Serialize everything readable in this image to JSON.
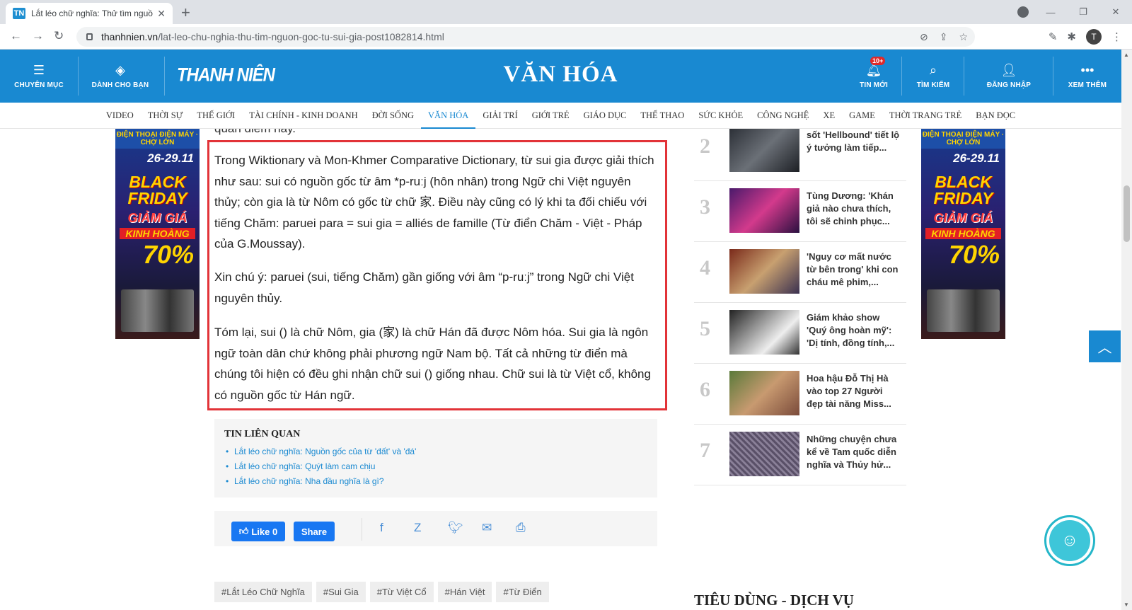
{
  "browser": {
    "tab_title": "Lắt léo chữ nghĩa: Thử tìm nguồn",
    "tab_favicon": "TN",
    "url_domain": "thanhnien.vn",
    "url_path": "/lat-leo-chu-nghia-thu-tim-nguon-goc-tu-sui-gia-post1082814.html",
    "profile_initial": "T"
  },
  "header": {
    "menu_label": "CHUYÊN MỤC",
    "for_you_label": "DÀNH CHO BẠN",
    "logo": "THANH NIÊN",
    "section": "VĂN HÓA",
    "news_label": "TIN MỚI",
    "news_badge": "10+",
    "search_label": "TÌM KIẾM",
    "login_label": "ĐĂNG NHẬP",
    "more_label": "XEM THÊM",
    "colors": {
      "brand": "#1989d1",
      "highlight": "#e23338"
    }
  },
  "categories": [
    "VIDEO",
    "THỜI SỰ",
    "THẾ GIỚI",
    "TÀI CHÍNH - KINH DOANH",
    "ĐỜI SỐNG",
    "VĂN HÓA",
    "GIẢI TRÍ",
    "GIỚI TRẺ",
    "GIÁO DỤC",
    "THỂ THAO",
    "SỨC KHỎE",
    "CÔNG NGHỆ",
    "XE",
    "GAME",
    "THỜI TRANG TRẺ",
    "BẠN ĐỌC"
  ],
  "active_category": "VĂN HÓA",
  "article": {
    "lead_fragment": "quan điểm này.",
    "p1": "Trong Wiktionary và Mon-Khmer Comparative Dictionary, từ sui gia được giải thích như sau: sui có nguồn gốc từ âm *p-ruːj (hôn nhân) trong Ngữ chi Việt nguyên thủy; còn gia là từ Nôm có gốc từ chữ 家. Điều này cũng có lý khi ta đối chiếu với tiếng Chăm: paruei para = sui gia = alliés de famille (Từ điển Chăm - Việt - Pháp của G.Moussay).",
    "p2": "Xin chú ý: paruei (sui, tiếng Chăm) gần giống với âm “p-ruːj” trong Ngữ chi Việt nguyên thủy.",
    "p3": "Tóm lại, sui (𡞕) là chữ Nôm, gia (家) là chữ Hán đã được Nôm hóa. Sui gia là ngôn ngữ toàn dân chứ không phải phương ngữ Nam bộ. Tất cả những từ điển mà chúng tôi hiện có đều ghi nhận chữ sui (𡞕) giống nhau. Chữ sui là từ Việt cổ, không có nguồn gốc từ Hán ngữ."
  },
  "related": {
    "heading": "TIN LIÊN QUAN",
    "items": [
      "Lắt léo chữ nghĩa: Nguồn gốc của từ 'đất' và 'đá'",
      "Lắt léo chữ nghĩa: Quýt làm cam chịu",
      "Lắt léo chữ nghĩa: Nha đầu nghĩa là gì?"
    ]
  },
  "share": {
    "like_label": "Like 0",
    "share_label": "Share"
  },
  "tags": [
    "#Lắt Léo Chữ Nghĩa",
    "#Sui Gia",
    "#Từ Việt Cổ",
    "#Hán Việt",
    "#Từ Điển"
  ],
  "most_read": [
    {
      "num": "2",
      "title": "sốt 'Hellbound' tiết lộ ý tưởng làm tiếp..."
    },
    {
      "num": "3",
      "title": "Tùng Dương: 'Khán giả nào chưa thích, tôi sẽ chinh phục..."
    },
    {
      "num": "4",
      "title": "'Nguy cơ mất nước từ bên trong' khi con cháu mê phim,..."
    },
    {
      "num": "5",
      "title": "Giám khảo show 'Quý ông hoàn mỹ': 'Dị tính, đồng tính,..."
    },
    {
      "num": "6",
      "title": "Hoa hậu Đỗ Thị Hà vào top 27 Người đẹp tài năng Miss..."
    },
    {
      "num": "7",
      "title": "Những chuyện chưa kể về Tam quốc diễn nghĩa và Thủy hử..."
    }
  ],
  "section_heading": "TIÊU DÙNG - DỊCH VỤ",
  "ad": {
    "top": "ĐIỆN THOẠI ĐIỆN MÁY · CHỢ LỚN",
    "date": "26-29.11",
    "black": "BLACK",
    "friday": "FRIDAY",
    "discount": "GIẢM GIÁ",
    "shock": "KINH HOÀNG",
    "percent": "70%"
  }
}
